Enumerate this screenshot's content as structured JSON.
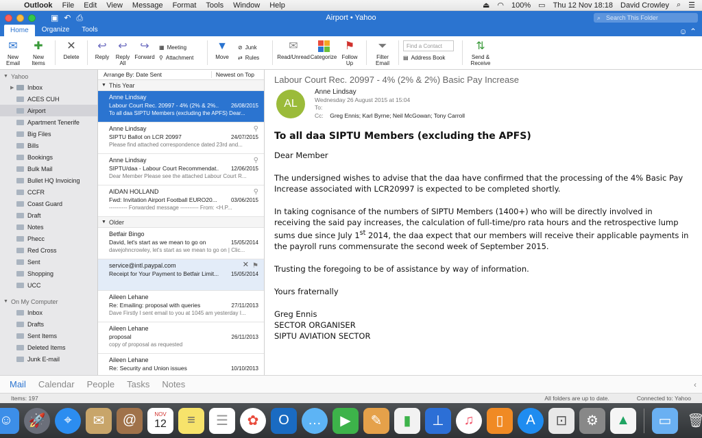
{
  "menubar": {
    "app": "Outlook",
    "items": [
      "File",
      "Edit",
      "View",
      "Message",
      "Format",
      "Tools",
      "Window",
      "Help"
    ],
    "battery": "100%",
    "datetime": "Thu 12 Nov  18:18",
    "user": "David Crowley"
  },
  "window": {
    "title": "Airport • Yahoo",
    "search_placeholder": "Search This Folder"
  },
  "tabs": [
    "Home",
    "Organize",
    "Tools"
  ],
  "ribbon": {
    "new_email": "New\nEmail",
    "new_items": "New\nItems",
    "delete": "Delete",
    "reply": "Reply",
    "reply_all": "Reply\nAll",
    "forward": "Forward",
    "meeting": "Meeting",
    "attachment": "Attachment",
    "move": "Move",
    "junk": "Junk",
    "rules": "Rules",
    "read_unread": "Read/Unread",
    "categorize": "Categorize",
    "follow_up": "Follow\nUp",
    "filter_email": "Filter\nEmail",
    "find_contact": "Find a Contact",
    "address_book": "Address Book",
    "send_receive": "Send &\nReceive"
  },
  "sidebar": {
    "account": "Yahoo",
    "folders": [
      "Inbox",
      "ACES CUH",
      "Airport",
      "Apartment Tenerife",
      "Big Files",
      "Bills",
      "Bookings",
      "Bulk Mail",
      "Bullet HQ Invoicing",
      "CCFR",
      "Coast Guard",
      "Draft",
      "Notes",
      "Phecc",
      "Red Cross",
      "Sent",
      "Shopping",
      "UCC"
    ],
    "local_header": "On My Computer",
    "local_folders": [
      "Inbox",
      "Drafts",
      "Sent Items",
      "Deleted Items",
      "Junk E-mail"
    ]
  },
  "list": {
    "arrange": "Arrange By: Date Sent",
    "order": "Newest on Top",
    "group1": "This Year",
    "group2": "Older",
    "messages_this_year": [
      {
        "from": "Anne Lindsay",
        "subject": "Labour Court Rec. 20997 - 4% (2% & 2%...",
        "date": "26/08/2015",
        "preview": "To all daa SIPTU Members (excluding the APFS) Dear..."
      },
      {
        "from": "Anne Lindsay",
        "subject": "SIPTU Ballot on LCR 20997",
        "date": "24/07/2015",
        "preview": "Please find attached correspondence dated 23rd and..."
      },
      {
        "from": "Anne Lindsay",
        "subject": "SIPTU/daa - Labour Court Recommendat...",
        "date": "12/06/2015",
        "preview": "Dear Member Please see the attached Labour Court R..."
      },
      {
        "from": "AIDAN HOLLAND",
        "subject": "Fwd: Invitation Airport Football EURO20...",
        "date": "03/06/2015",
        "preview": "---------- Forwarded message ---------- From: <H.P..."
      }
    ],
    "messages_older": [
      {
        "from": "Betfair Bingo",
        "subject": "David, let's start as we mean to go on",
        "date": "15/05/2014",
        "preview": "davejohncrowley, let's start as we mean to go on | Clic..."
      },
      {
        "from": "service@intl.paypal.com",
        "subject": "Receipt for Your Payment to Betfair Limit...",
        "date": "15/05/2014",
        "preview": ""
      },
      {
        "from": "Aileen Lehane",
        "subject": "Re: Emailing: proposal with queries",
        "date": "27/11/2013",
        "preview": "Dave Firstly I sent email to you at 1045 am yesterday I..."
      },
      {
        "from": "Aileen Lehane",
        "subject": "proposal",
        "date": "26/11/2013",
        "preview": "copy of proposal as requested"
      },
      {
        "from": "Aileen Lehane",
        "subject": "Re: Security and Union issues",
        "date": "10/10/2013",
        "preview": ""
      }
    ]
  },
  "reader": {
    "subject": "Labour Court Rec. 20997 - 4% (2% & 2%) Basic Pay Increase",
    "initials": "AL",
    "from": "Anne Lindsay",
    "sent": "Wednesday 26 August 2015 at 15:04",
    "to_label": "To:",
    "cc_label": "Cc:",
    "cc": "Greg Ennis;   Karl Byrne;   Neil McGowan;   Tony Carroll",
    "heading": "To all daa SIPTU Members (excluding the APFS)",
    "greeting": "Dear Member",
    "para1": "The undersigned wishes to advise that the daa have confirmed that the processing of the 4% Basic Pay Increase associated with LCR20997 is expected to be completed shortly.",
    "para2a": "In taking cognisance of the numbers of SIPTU Members (1400+) who will be directly involved in receiving the said pay increases, the calculation of full-time/pro rata hours and the retrospective lump sums due since July 1",
    "para2sup": "st",
    "para2b": " 2014, the daa expect that our members will receive their applicable payments in the payroll runs commensurate the second week of September 2015.",
    "para3": "Trusting the foregoing to be of assistance by way of information.",
    "closing": "Yours fraternally",
    "sig1": "Greg Ennis",
    "sig2": "SECTOR ORGANISER",
    "sig3": "SIPTU AVIATION SECTOR"
  },
  "nav": {
    "mail": "Mail",
    "calendar": "Calendar",
    "people": "People",
    "tasks": "Tasks",
    "notes": "Notes"
  },
  "status": {
    "items": "Items: 197",
    "sync": "All folders are up to date.",
    "connected": "Connected to: Yahoo"
  },
  "dock": {
    "calendar_month": "NOV",
    "calendar_day": "12"
  }
}
